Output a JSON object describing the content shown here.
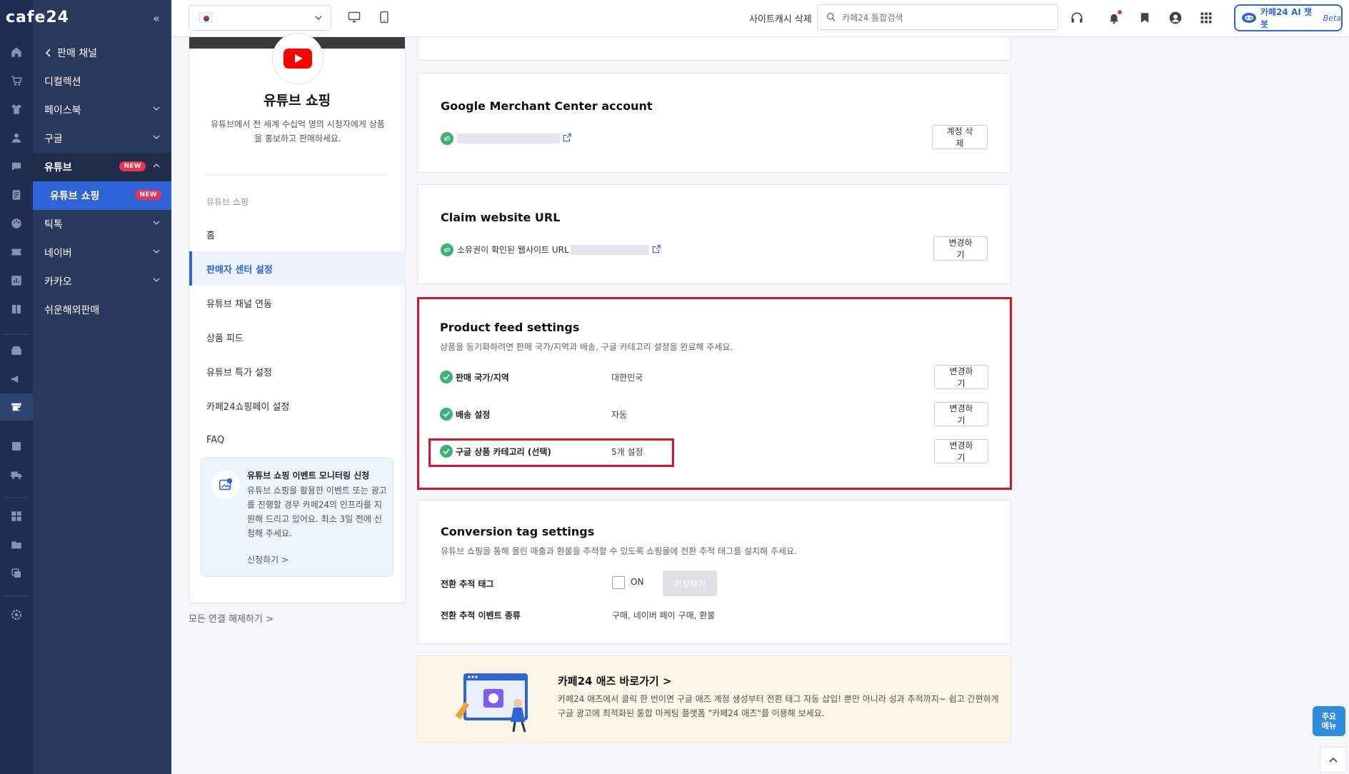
{
  "app": {
    "logo": "cafe24",
    "collapse_icon": "double-chevron-left-icon"
  },
  "menu": {
    "back_label": "판매 채널",
    "items": [
      {
        "label": "디컬렉션"
      },
      {
        "label": "페이스북"
      },
      {
        "label": "구글"
      },
      {
        "label": "유튜브",
        "badge": "NEW"
      },
      {
        "label": "유튜브 쇼핑",
        "badge": "NEW"
      },
      {
        "label": "틱톡"
      },
      {
        "label": "네이버"
      },
      {
        "label": "카카오"
      },
      {
        "label": "쉬운해외판매"
      }
    ]
  },
  "topbar": {
    "language_flag": "korea-flag-icon",
    "cache_delete": "사이트캐시 삭제",
    "search_placeholder": "카페24 통합검색",
    "ai_label": "카페24 AI 챗봇",
    "ai_beta": "Beta"
  },
  "left_panel": {
    "title": "유튜브 쇼핑",
    "description": "유튜브에서 전 세계 수십억 명의 시청자에게 상품을 홍보하고 판매하세요.",
    "group_label": "유튜브 쇼핑",
    "nav": [
      {
        "label": "홈"
      },
      {
        "label": "판매자 센터 설정",
        "active": true
      },
      {
        "label": "유튜브 채널 연동"
      },
      {
        "label": "상품 피드"
      },
      {
        "label": "유튜브 특가 설정"
      },
      {
        "label": "카페24쇼핑페이 설정"
      },
      {
        "label": "FAQ"
      }
    ],
    "promo": {
      "title": "유튜브 쇼핑 이벤트 모니터링 신청",
      "description": "유튜브 쇼핑을 활용한 이벤트 또는 광고를 진행할 경우 카페24의 인프라를 지원해 드리고 있어요. 최소 3일 전에 신청해 주세요.",
      "link": "신청하기 >"
    },
    "disconnect_all": "모든 연결 해제하기 >"
  },
  "merchant": {
    "title": "Google Merchant Center account",
    "button": "계정 삭제"
  },
  "claim": {
    "title": "Claim website URL",
    "label": "소유권이 확인된 웹사이트 URL",
    "button": "변경하기"
  },
  "feed": {
    "title": "Product feed settings",
    "subtitle": "상품을 동기화하려면 판매 국가/지역과 배송, 구글 카테고리 설정을 완료해 주세요.",
    "rows": [
      {
        "label": "판매 국가/지역",
        "value": "대한민국",
        "button": "변경하기"
      },
      {
        "label": "배송 설정",
        "value": "자동",
        "button": "변경하기"
      },
      {
        "label": "구글 상품 카테고리 (선택)",
        "value": "5개 설정",
        "button": "변경하기"
      }
    ]
  },
  "conversion": {
    "title": "Conversion tag settings",
    "subtitle": "유튜브 쇼핑을 통해 올린 매출과 환불을 추적할 수 있도록 쇼핑몰에 전환 추적 태그를 설치해 주세요.",
    "tag_label": "전환 추적 태그",
    "checkbox_label": "ON",
    "checkbox_checked": false,
    "save_button": "저장하기",
    "event_label": "전환 추적 이벤트 종류",
    "event_value": "구매, 네이버 페이 구매, 환불"
  },
  "ads": {
    "title": "카페24 애즈 바로가기 >",
    "description": "카페24 애즈에서 클릭 한 번이면 구글 애즈 계정 생성부터 전환 태그 자동 삽입! 뿐만 아니라 성과 추적까지~ 쉽고 간편하게 구글 광고에 최적화된 통합 마케팅 플랫폼 \"카페24 애즈\"를 이용해 보세요."
  },
  "floating": {
    "quick_menu": "주요\n메뉴",
    "to_top_icon": "chevron-up-icon"
  },
  "colors": {
    "accent": "#2f64d9",
    "highlight": "#d7152a",
    "success": "#3bb273",
    "sidebar": "#2a3a5c",
    "rail": "#202f4f"
  }
}
